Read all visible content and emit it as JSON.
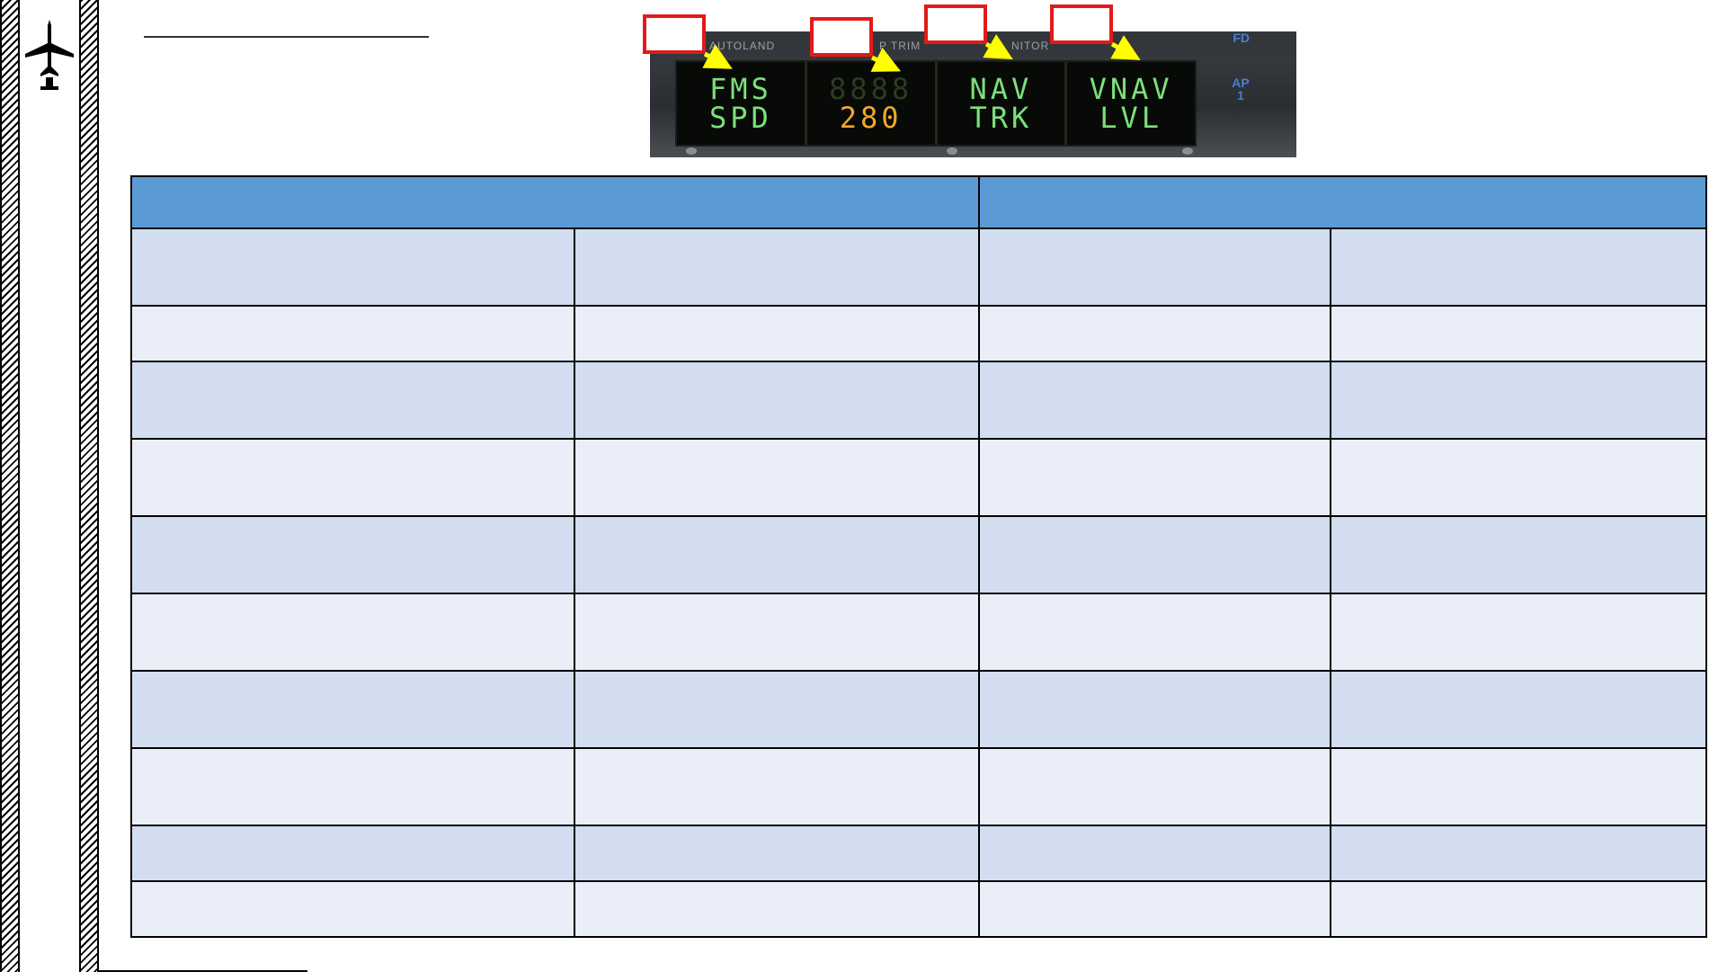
{
  "panel": {
    "top_labels": [
      "AUTOLAND",
      "P TRIM",
      "NITOR"
    ],
    "side_labels": [
      "FD",
      "AP 1"
    ],
    "annunciators": [
      {
        "line1": "FMS",
        "line2": "SPD",
        "line1_color": "green",
        "line2_color": "green"
      },
      {
        "line1": "",
        "line2": "280",
        "line1_color": "dim",
        "line2_color": "amber"
      },
      {
        "line1": "NAV",
        "line2": "TRK",
        "line1_color": "green",
        "line2_color": "green"
      },
      {
        "line1": "VNAV",
        "line2": "LVL",
        "line1_color": "green",
        "line2_color": "green"
      }
    ]
  },
  "table": {
    "header": [
      "",
      ""
    ],
    "rows": [
      {
        "shade": "dark",
        "cells": [
          "",
          "",
          "",
          ""
        ]
      },
      {
        "shade": "light",
        "cells": [
          "",
          "",
          "",
          ""
        ]
      },
      {
        "shade": "dark",
        "cells": [
          "",
          "",
          "",
          ""
        ]
      },
      {
        "shade": "light",
        "cells": [
          "",
          "",
          "",
          ""
        ]
      },
      {
        "shade": "dark",
        "cells": [
          "",
          "",
          "",
          ""
        ]
      },
      {
        "shade": "light",
        "cells": [
          "",
          "",
          "",
          ""
        ]
      },
      {
        "shade": "dark",
        "cells": [
          "",
          "",
          "",
          ""
        ]
      },
      {
        "shade": "light",
        "cells": [
          "",
          "",
          "",
          ""
        ]
      },
      {
        "shade": "dark",
        "cells": [
          "",
          "",
          "",
          ""
        ]
      },
      {
        "shade": "light",
        "cells": [
          "",
          "",
          "",
          ""
        ]
      }
    ]
  },
  "colors": {
    "table_header": "#5b9bd5",
    "row_dark": "#d2deef",
    "row_light": "#eaeef8",
    "callout_border": "#e21a1a",
    "arrow": "#ffff00",
    "display_green": "#7be07a",
    "display_amber": "#f0a92c"
  },
  "icons": [
    "airplane-icon"
  ]
}
